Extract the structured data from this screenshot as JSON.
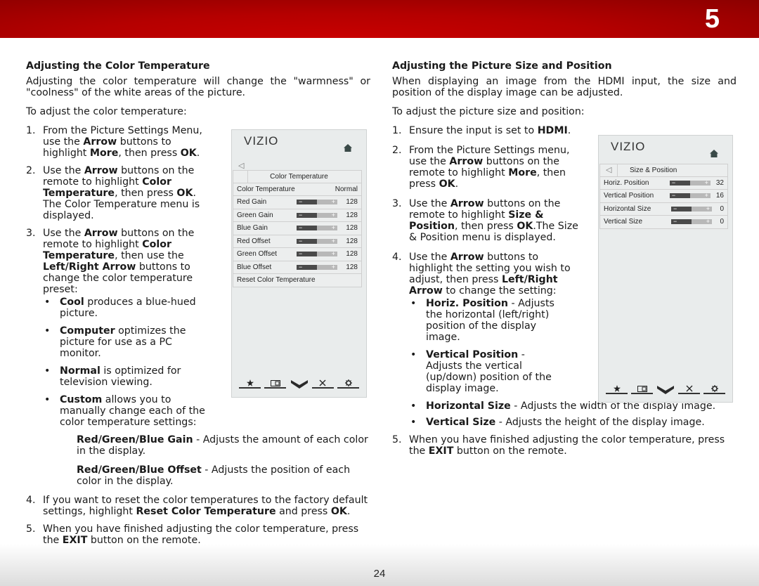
{
  "header": {
    "chapter_number": "5"
  },
  "footer": {
    "page_number": "24"
  },
  "left": {
    "heading": "Adjusting the Color Temperature",
    "intro": "Adjusting the color temperature will change the \"warmness\" or \"coolness\" of the white areas of the picture.",
    "lead": "To adjust the color temperature:",
    "steps": [
      {
        "num": "1.",
        "parts": [
          "From the Picture Settings Menu, use the ",
          "Arrow",
          " buttons to highlight ",
          "More",
          ", then press ",
          "OK",
          "."
        ]
      },
      {
        "num": "2.",
        "parts": [
          "Use the ",
          "Arrow",
          " buttons on the remote to highlight ",
          "Color Temperature",
          ", then press ",
          "OK",
          ". The Color Temperature menu is displayed."
        ]
      },
      {
        "num": "3.",
        "parts": [
          "Use the ",
          "Arrow",
          " buttons on the remote to highlight ",
          "Color Temperature",
          ", then use the ",
          "Left/Right Arrow",
          " buttons to change the color temperature preset:"
        ]
      },
      {
        "num": "4.",
        "parts": [
          "If you want to reset the color temperatures to the factory default settings, highlight ",
          "Reset Color Temperature",
          " and press ",
          "OK",
          "."
        ]
      },
      {
        "num": "5.",
        "parts": [
          "When you have finished adjusting the color temperature, press the ",
          "EXIT",
          " button on the remote."
        ]
      }
    ],
    "presets": [
      {
        "term": "Cool",
        "desc": " produces a blue-hued picture."
      },
      {
        "term": "Computer",
        "desc": " optimizes the picture for use as a PC monitor."
      },
      {
        "term": "Normal",
        "desc": " is optimized for television viewing."
      },
      {
        "term": "Custom",
        "desc": " allows you to manually change each of the color temperature settings:"
      }
    ],
    "custom_settings": [
      {
        "term": "Red/Green/Blue Gain",
        "desc": " - Adjusts the amount of each color in the display."
      },
      {
        "term": "Red/Green/Blue Offset",
        "desc": " - Adjusts the position of each color in the display."
      }
    ]
  },
  "right": {
    "heading": "Adjusting the Picture Size and Position",
    "intro": "When displaying an image from the HDMI input, the size and position of the display image can be adjusted.",
    "lead": "To adjust the picture size and position:",
    "steps": [
      {
        "num": "1.",
        "parts": [
          "Ensure the input is set to ",
          "HDMI",
          "."
        ]
      },
      {
        "num": "2.",
        "parts": [
          "From the Picture Settings menu, use the ",
          "Arrow",
          " buttons on the remote to highlight ",
          "More",
          ", then press ",
          "OK",
          "."
        ]
      },
      {
        "num": "3.",
        "parts": [
          "Use the ",
          "Arrow",
          " buttons on the remote to highlight ",
          "Size & Position",
          ", then press ",
          "OK",
          ".The Size & Position menu is displayed."
        ]
      },
      {
        "num": "4.",
        "parts": [
          "Use the ",
          "Arrow",
          " buttons to highlight the setting you wish to adjust, then press ",
          "Left/Right Arrow",
          " to change the setting:"
        ]
      },
      {
        "num": "5.",
        "parts": [
          "When you have finished adjusting the color temperature, press the ",
          "EXIT",
          " button on the remote."
        ]
      }
    ],
    "settings": [
      {
        "term": "Horiz. Position",
        "desc": " - Adjusts the horizontal (left/right) position of the display image."
      },
      {
        "term": "Vertical Position",
        "desc": " - Adjusts the vertical (up/down) position of the display image."
      },
      {
        "term": "Horizontal Size",
        "desc": " - Adjusts the width of the display image."
      },
      {
        "term": "Vertical Size",
        "desc": " - Adjusts the height of the display image."
      }
    ]
  },
  "tv_color_temp": {
    "logo": "VIZIO",
    "menu_title": "Color Temperature",
    "rows": [
      {
        "label": "Color Temperature",
        "value": "Normal",
        "slider": null
      },
      {
        "label": "Red Gain",
        "value": "128",
        "slider": 0.5
      },
      {
        "label": "Green Gain",
        "value": "128",
        "slider": 0.5
      },
      {
        "label": "Blue Gain",
        "value": "128",
        "slider": 0.5
      },
      {
        "label": "Red Offset",
        "value": "128",
        "slider": 0.5
      },
      {
        "label": "Green Offset",
        "value": "128",
        "slider": 0.5
      },
      {
        "label": "Blue Offset",
        "value": "128",
        "slider": 0.5
      },
      {
        "label": "Reset Color Temperature",
        "value": "",
        "slider": null
      }
    ],
    "nav_icons": [
      "star-icon",
      "picture-icon",
      "vizio-v-icon",
      "close-icon",
      "gear-icon"
    ]
  },
  "tv_size_position": {
    "logo": "VIZIO",
    "menu_title": "Size & Position",
    "rows": [
      {
        "label": "Horiz. Position",
        "value": "32",
        "slider": 0.5
      },
      {
        "label": "Vertical Position",
        "value": "16",
        "slider": 0.5
      },
      {
        "label": "Horizontal Size",
        "value": "0",
        "slider": 0.5
      },
      {
        "label": "Vertical Size",
        "value": "0",
        "slider": 0.5
      }
    ],
    "nav_icons": [
      "star-icon",
      "picture-icon",
      "vizio-v-icon",
      "close-icon",
      "gear-icon"
    ]
  },
  "colors": {
    "header_red": "#c80000",
    "menu_bg": "#e9ecec"
  }
}
